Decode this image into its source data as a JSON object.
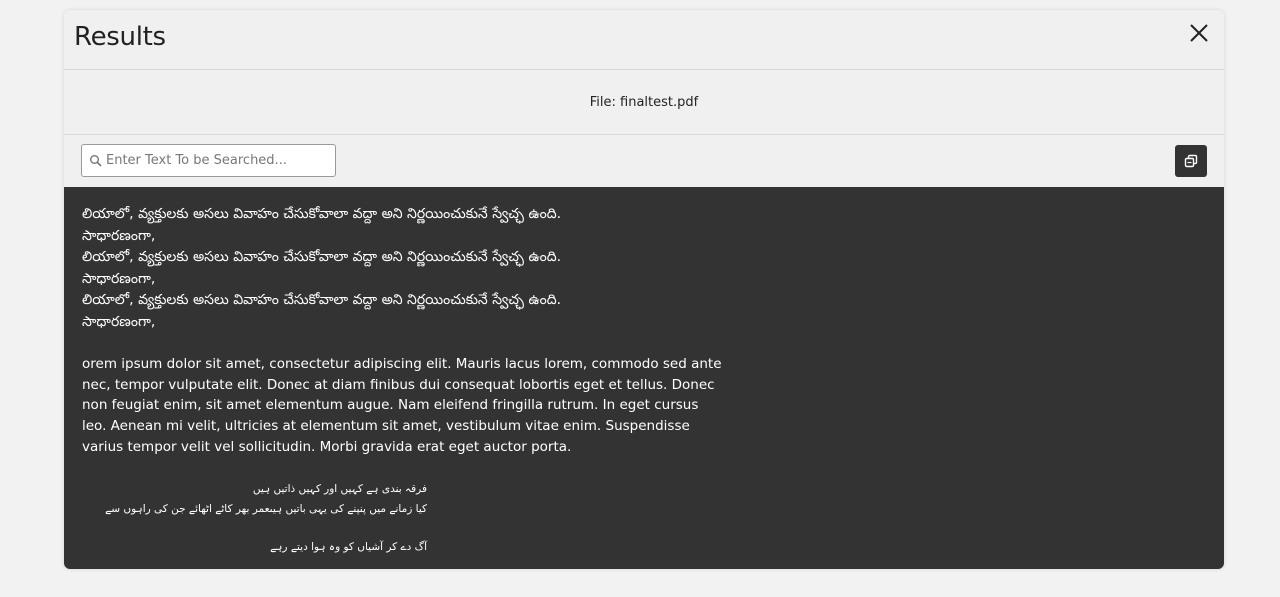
{
  "dialog": {
    "title": "Results",
    "file_label": "File: finaltest.pdf"
  },
  "search": {
    "placeholder": "Enter Text To be Searched...",
    "value": ""
  },
  "content": {
    "telugu_lines": [
      "లియాలో, వ్యక్తులకు అసలు వివాహం చేసుకోవాలా వద్దా అని నిర్ణయించుకునే స్వేచ్ఛ ఉంది.",
      "సాధారణంగా,",
      "లియాలో, వ్యక్తులకు అసలు వివాహం చేసుకోవాలా వద్దా అని నిర్ణయించుకునే స్వేచ్ఛ ఉంది.",
      "సాధారణంగా,",
      "లియాలో, వ్యక్తులకు అసలు వివాహం చేసుకోవాలా వద్దా అని నిర్ణయించుకునే స్వేచ్ఛ ఉంది.",
      "సాధారణంగా,"
    ],
    "lorem": "orem ipsum dolor sit amet, consectetur adipiscing elit. Mauris lacus lorem, commodo sed ante nec, tempor vulputate elit. Donec at diam finibus dui consequat lobortis eget et tellus. Donec non feugiat enim, sit amet elementum augue. Nam eleifend fringilla rutrum. In eget cursus leo. Aenean mi velit, ultricies at elementum sit amet, vestibulum vitae enim. Suspendisse varius tempor velit vel sollicitudin. Morbi gravida erat eget auctor porta.",
    "urdu_lines": [
      "فرقہ بندی ہے کہیں اور کہیں ذاتیں ہیں",
      "کیا زمانے میں پنپنے کی یہی باتیں ہیںعمر بھر کاٹے اٹھائے جن کی راہوں سے",
      "آگ دے کر آشیاں کو وہ ہوا دیتے رہے"
    ]
  },
  "colors": {
    "content_background": "#333333",
    "modal_background": "#f0f0f0"
  },
  "icons": {
    "close": "close-icon",
    "search": "search-icon",
    "copy": "copy-icon"
  }
}
